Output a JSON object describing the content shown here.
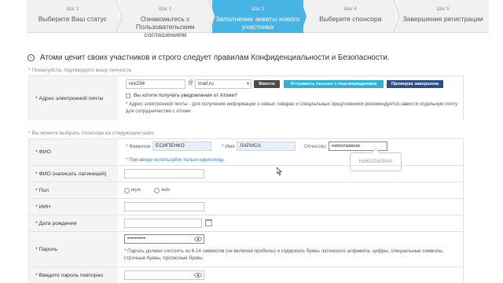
{
  "steps": [
    {
      "num": "Шаг 1",
      "title": "Выберите Ваш статус"
    },
    {
      "num": "Шаг 2",
      "title": "Ознакомьтесь с Пользовательским соглашением"
    },
    {
      "num": "Шаг 3",
      "title": "Заполнение анкеты нового участника"
    },
    {
      "num": "Шаг 4",
      "title": "Выберите спонсора"
    },
    {
      "num": "Шаг 5",
      "title": "Завершение регистрации"
    }
  ],
  "active_step": 3,
  "heading": "Атоми ценит своих участников и строго следует правилам Конфиденциальности и Безопасности.",
  "notes": {
    "confirm_identity": "* Пожалуйста, подтвердите вашу личность",
    "choose_sponsor": "* Вы можете выбрать спонсора на следующем шаге."
  },
  "email": {
    "label": "* Адрес электронной почты",
    "local_value": "rex234",
    "at": "@",
    "domain_value": "mail.ru",
    "enter_button": "Ввести",
    "send_button": "Отправить письмо с подтверждением",
    "verified_button": "Проверка завершена",
    "notify_label": "Вы хотите получать уведомления от Атоми?",
    "notify_checked": false,
    "hint": "* Адрес электронной почты - для получения информации о новых товарах и специальных предложениях рекомендуется завести отдельную почту для сотрудничества с Атоми"
  },
  "fio": {
    "label": "* ФИО",
    "surname_label": "* Фамилия",
    "surname_value": "ЕСИПЕНКО",
    "name_label": "* Имя",
    "name_value": "ЛАРИСА",
    "patronymic_label": "Отчество",
    "patronymic_value": "николаевна",
    "hint": "* При вводе используйте только кириллицу.",
    "tooltip": "НИКОЛАЕВНА"
  },
  "fio_latin": {
    "label": "* ФИО (написать латиницей)",
    "value": ""
  },
  "gender": {
    "label": "* Пол",
    "options": [
      "муж",
      "жен"
    ],
    "selected": null
  },
  "iin": {
    "label": "* ИИН",
    "value": ""
  },
  "birth": {
    "label": "* Дата рождения",
    "value": ""
  },
  "password": {
    "label": "* Пароль",
    "value": "••••••••••",
    "hint": "* Пароль должен состоять из 6-14 символов (не включая пробелы) и содержать буквы латинского алфавита, цифры, специальные символы, строчные буквы, прописные буквы."
  },
  "password_repeat": {
    "label": "* Введите пароль повторно",
    "value": ""
  },
  "colors": {
    "active_step": "#47b4e6",
    "send_button": "#2fb1d7",
    "verified_button": "#2c4f86",
    "input_autofill": "#e8f1fb"
  }
}
